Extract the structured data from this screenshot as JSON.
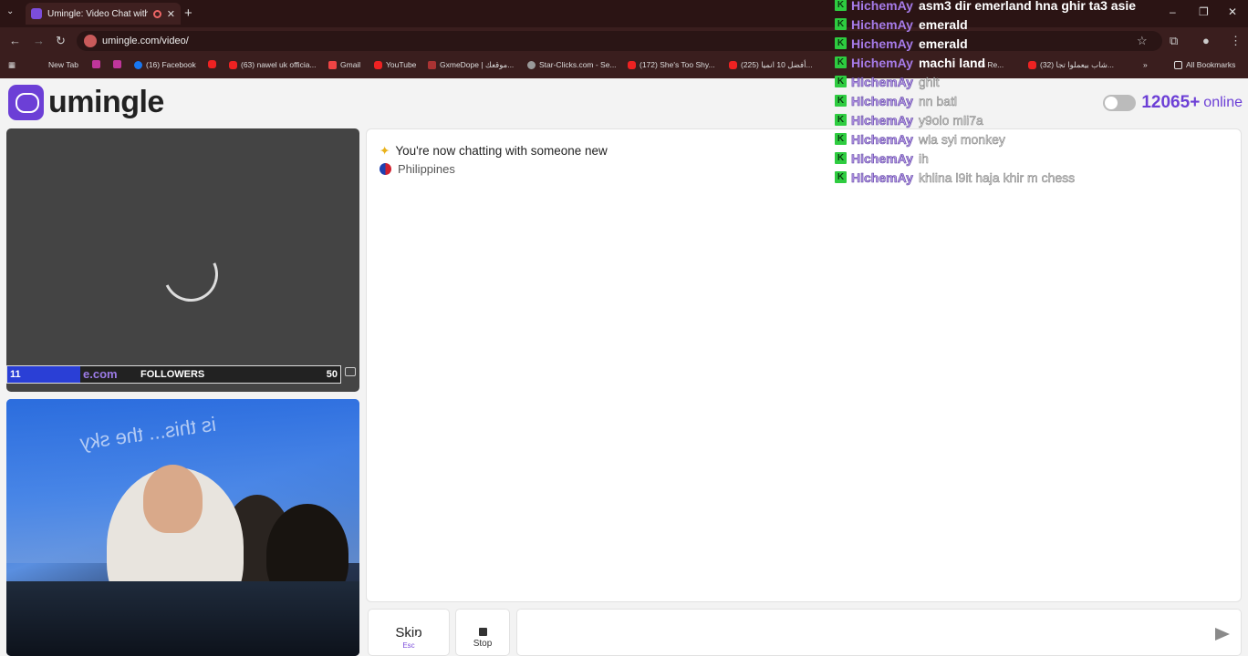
{
  "browser": {
    "tab_title": "Umingle: Video Chat with S",
    "url": "umingle.com/video/",
    "bookmarks": [
      {
        "label": "New Tab",
        "icon": "grid-icon"
      },
      {
        "label": "",
        "icon": "instagram-icon"
      },
      {
        "label": "",
        "icon": "instagram-icon"
      },
      {
        "label": "(16) Facebook",
        "icon": "facebook-icon"
      },
      {
        "label": "",
        "icon": "youtube-icon"
      },
      {
        "label": "(63) nawel uk officia...",
        "icon": "youtube-icon"
      },
      {
        "label": "Gmail",
        "icon": "gmail-icon"
      },
      {
        "label": "YouTube",
        "icon": "youtube-icon"
      },
      {
        "label": "GxmeDope | موقعك...",
        "icon": "gxmedope-icon"
      },
      {
        "label": "Star-Clicks.com - Se...",
        "icon": "globe-icon"
      },
      {
        "label": "(172) She's Too Shy...",
        "icon": "youtube-icon"
      },
      {
        "label": "(225) أفضل 10 انميا...",
        "icon": "youtube-icon"
      },
      {
        "label": "...'s Re...",
        "icon": "youtube-icon"
      },
      {
        "label": "(32) شاب بيعملوا تجا...",
        "icon": "youtube-icon"
      },
      {
        "label": "All Bookmarks",
        "icon": "folder-icon"
      }
    ]
  },
  "site": {
    "logo_text": "umingle",
    "online_count": "12065+",
    "online_label": "online"
  },
  "remote_video": {
    "overlay_left": "11",
    "overlay_domain": "e.com",
    "overlay_label": "FOLLOWERS",
    "overlay_right": "50"
  },
  "local_video": {
    "wall_text": "is this... the sky"
  },
  "chat": {
    "status": "You're now chatting with someone new",
    "country": "Philippines"
  },
  "controls": {
    "skip_label": "Skip",
    "skip_hint": "Esc",
    "stop_label": "Stop",
    "message_placeholder": ""
  },
  "stream_chat": [
    {
      "user": "HichemAy",
      "message": "asm3 dir emerland hna ghir ta3 asie",
      "style": "bright"
    },
    {
      "user": "HichemAy",
      "message": "emerald",
      "style": "bright"
    },
    {
      "user": "HichemAy",
      "message": "emerald",
      "style": "bright"
    },
    {
      "user": "HichemAy",
      "message": "machi land",
      "style": "bright"
    },
    {
      "user": "HichemAy",
      "message": "ghlt",
      "style": "light"
    },
    {
      "user": "HichemAy",
      "message": "nn batl",
      "style": "light"
    },
    {
      "user": "HichemAy",
      "message": "y9olo mli7a",
      "style": "light"
    },
    {
      "user": "HichemAy",
      "message": "wla syi monkey",
      "style": "light"
    },
    {
      "user": "HichemAy",
      "message": "ih",
      "style": "light"
    },
    {
      "user": "HichemAy",
      "message": "khlina l9it haja khir m chess",
      "style": "light"
    }
  ],
  "colors": {
    "brand": "#6c3fd6",
    "browser_frame": "#3a1e1e",
    "badge_green": "#2ecc40"
  }
}
